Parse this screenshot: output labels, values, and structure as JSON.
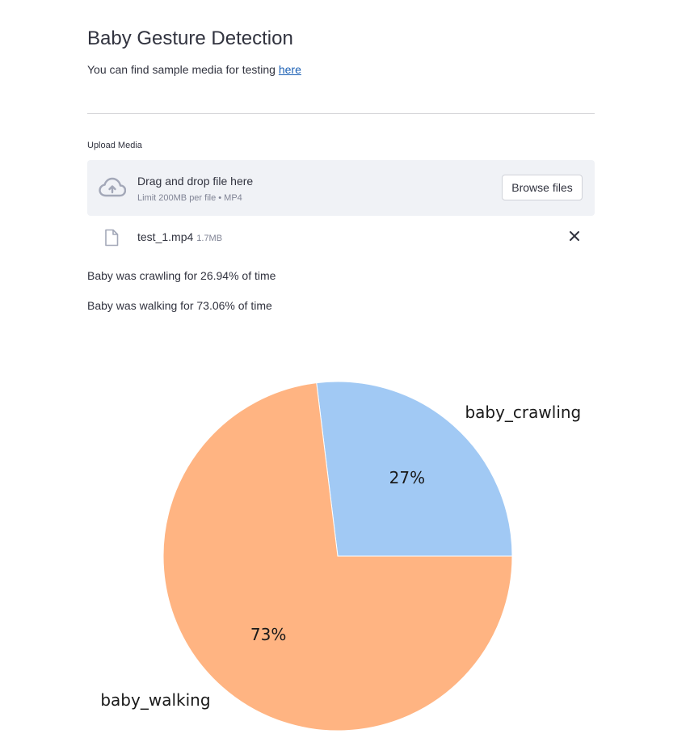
{
  "page": {
    "title": "Baby Gesture Detection",
    "subtitle_prefix": "You can find sample media for testing ",
    "subtitle_link": "here"
  },
  "uploader": {
    "label": "Upload Media",
    "drop_text": "Drag and drop file here",
    "limit_text": "Limit 200MB per file • MP4",
    "browse_label": "Browse files",
    "cloud_icon": "cloud-upload-icon"
  },
  "file": {
    "name": "test_1.mp4",
    "size": "1.7MB",
    "file_icon": "file-icon",
    "remove_icon": "close-icon"
  },
  "results": [
    "Baby was crawling for 26.94% of time",
    "Baby was walking for 73.06% of time"
  ],
  "chart_data": {
    "type": "pie",
    "categories": [
      "baby_crawling",
      "baby_walking"
    ],
    "values": [
      26.94,
      73.06
    ],
    "labels_pct": [
      "27%",
      "73%"
    ],
    "colors": [
      "#a1c9f4",
      "#ffb482"
    ],
    "title": ""
  }
}
